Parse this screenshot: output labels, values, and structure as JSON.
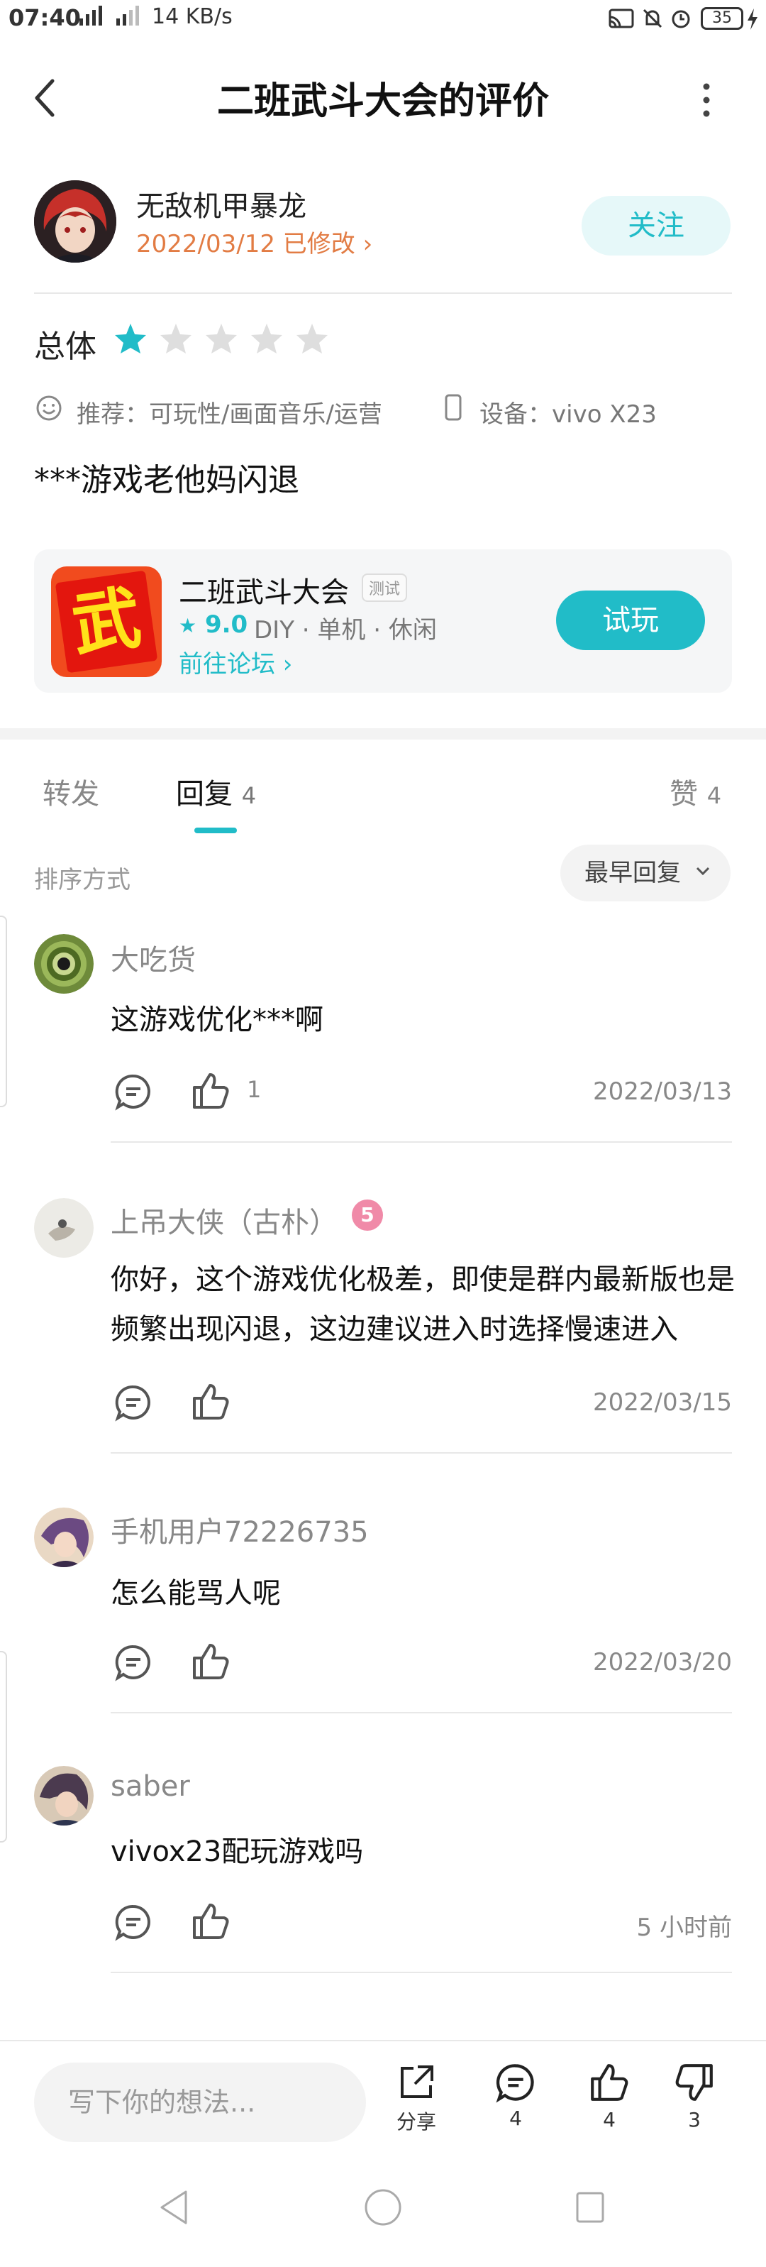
{
  "status_bar": {
    "time": "07:40",
    "network_speed": "14 KB/s",
    "battery": "35"
  },
  "nav": {
    "title": "二班武斗大会的评价"
  },
  "author": {
    "name": "无敌机甲暴龙",
    "meta": "2022/03/12 已修改 ›",
    "follow_label": "关注"
  },
  "rating": {
    "label": "总体",
    "stars": 1,
    "max_stars": 5,
    "star_color": "#21bcc8"
  },
  "recommend": {
    "text": "推荐：可玩性/画面音乐/运营",
    "device": "设备：vivo X23"
  },
  "review": {
    "text": "***游戏老他妈闪退"
  },
  "game": {
    "icon_glyph": "武",
    "name": "二班武斗大会",
    "tag": "测试",
    "score": "9.0",
    "tags": "DIY · 单机 · 休闲",
    "forum_link": "前往论坛 ›",
    "play_label": "试玩"
  },
  "tabs": [
    {
      "label": "转发",
      "count": ""
    },
    {
      "label": "回复",
      "count": "4"
    },
    {
      "label": "赞",
      "count": "4"
    }
  ],
  "sort": {
    "label": "排序方式",
    "value": "最早回复"
  },
  "comments": [
    {
      "name": "大吃货",
      "text": "这游戏优化***啊",
      "likes": "1",
      "date": "2022/03/13"
    },
    {
      "name": "上吊大侠（古朴）",
      "badge": "5",
      "text": "你好，这个游戏优化极差，即使是群内最新版也是频繁出现闪退，这边建议进入时选择慢速进入",
      "likes": "",
      "date": "2022/03/15"
    },
    {
      "name": "手机用户72226735",
      "text": "怎么能骂人呢",
      "likes": "",
      "date": "2022/03/20"
    },
    {
      "name": "saber",
      "text": "vivox23配玩游戏吗",
      "likes": "",
      "date": "5 小时前"
    }
  ],
  "bottom": {
    "input_placeholder": "写下你的想法...",
    "share_label": "分享",
    "comment_count": "4",
    "like_count": "4",
    "dislike_count": "3"
  },
  "colors": {
    "accent": "#21bcc8",
    "orange": "#e27c44"
  }
}
